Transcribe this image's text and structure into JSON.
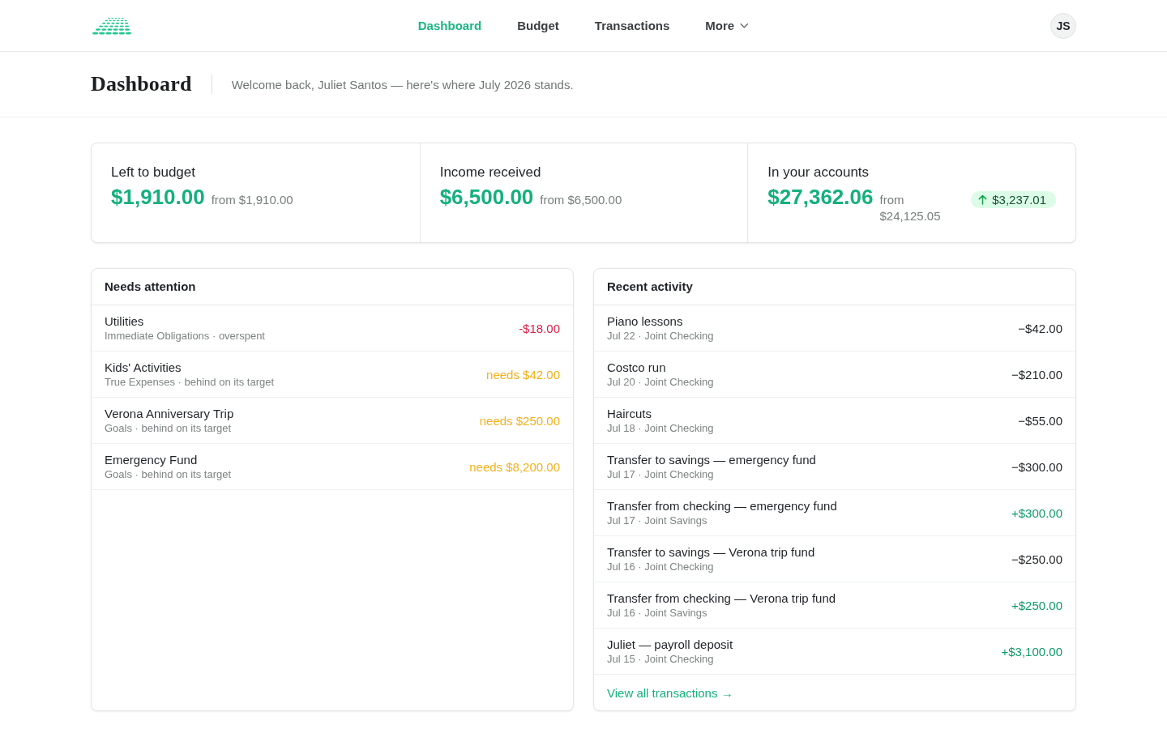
{
  "nav": {
    "items": [
      {
        "label": "Dashboard",
        "selected": true,
        "has_menu": false
      },
      {
        "label": "Budget",
        "selected": false,
        "has_menu": false
      },
      {
        "label": "Transactions",
        "selected": false,
        "has_menu": false
      },
      {
        "label": "More",
        "selected": false,
        "has_menu": true
      }
    ],
    "avatar": "JS"
  },
  "page_header": {
    "title": "Dashboard",
    "subtitle": "Welcome back, Juliet Santos — here's where July 2026 stands."
  },
  "stats": [
    {
      "label": "Left to budget",
      "amount": "$1,910.00",
      "from": "from $1,910.00"
    },
    {
      "label": "Income received",
      "amount": "$6,500.00",
      "from": "from $6,500.00"
    },
    {
      "label": "In your accounts",
      "amount": "$27,362.06",
      "from": "from $24,125.05",
      "delta": {
        "increase": true,
        "text": "$3,237.01"
      }
    }
  ],
  "needs_attention": {
    "title": "Needs attention",
    "rows": [
      {
        "name": "Utilities",
        "detail": "Immediate Obligations · overspent",
        "amount": "-$18.00",
        "kind": "overspent"
      },
      {
        "name": "Kids' Activities",
        "detail": "True Expenses · behind on its target",
        "amount": "needs $42.00",
        "kind": "underfunded"
      },
      {
        "name": "Verona Anniversary Trip",
        "detail": "Goals · behind on its target",
        "amount": "needs $250.00",
        "kind": "underfunded"
      },
      {
        "name": "Emergency Fund",
        "detail": "Goals · behind on its target",
        "amount": "needs $8,200.00",
        "kind": "underfunded"
      }
    ]
  },
  "recent_activity": {
    "title": "Recent activity",
    "rows": [
      {
        "name": "Piano lessons",
        "detail": "Jul 22 · Joint Checking",
        "amount": "−$42.00",
        "kind": "outflow"
      },
      {
        "name": "Costco run",
        "detail": "Jul 20 · Joint Checking",
        "amount": "−$210.00",
        "kind": "outflow"
      },
      {
        "name": "Haircuts",
        "detail": "Jul 18 · Joint Checking",
        "amount": "−$55.00",
        "kind": "outflow"
      },
      {
        "name": "Transfer to savings — emergency fund",
        "detail": "Jul 17 · Joint Checking",
        "amount": "−$300.00",
        "kind": "outflow"
      },
      {
        "name": "Transfer from checking — emergency fund",
        "detail": "Jul 17 · Joint Savings",
        "amount": "+$300.00",
        "kind": "inflow"
      },
      {
        "name": "Transfer to savings — Verona trip fund",
        "detail": "Jul 16 · Joint Checking",
        "amount": "−$250.00",
        "kind": "outflow"
      },
      {
        "name": "Transfer from checking — Verona trip fund",
        "detail": "Jul 16 · Joint Savings",
        "amount": "+$250.00",
        "kind": "inflow"
      },
      {
        "name": "Juliet — payroll deposit",
        "detail": "Jul 15 · Joint Checking",
        "amount": "+$3,100.00",
        "kind": "inflow"
      }
    ],
    "footer_link": "View all transactions →"
  }
}
